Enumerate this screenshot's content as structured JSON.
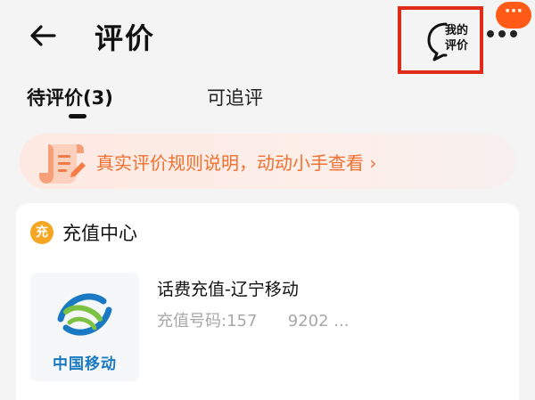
{
  "header": {
    "title": "评价",
    "my_review_label": "我的\n评价",
    "notification_badge": "···"
  },
  "tabs": [
    {
      "label": "待评价(3)",
      "active": true
    },
    {
      "label": "可追评",
      "active": false
    }
  ],
  "banner": {
    "text": "真实评价规则说明，动动小手查看 ›"
  },
  "order": {
    "store_name": "充值中心",
    "store_icon_char": "充",
    "product_title": "话费充值-辽宁移动",
    "product_detail": "充值号码:157      9202 ...",
    "brand_text": "中国移动"
  },
  "colors": {
    "accent": "#f0702f",
    "highlight_border": "#e02a1c",
    "badge": "#ff5a16",
    "brand_blue": "#1979c2",
    "brand_green": "#7cc242"
  }
}
